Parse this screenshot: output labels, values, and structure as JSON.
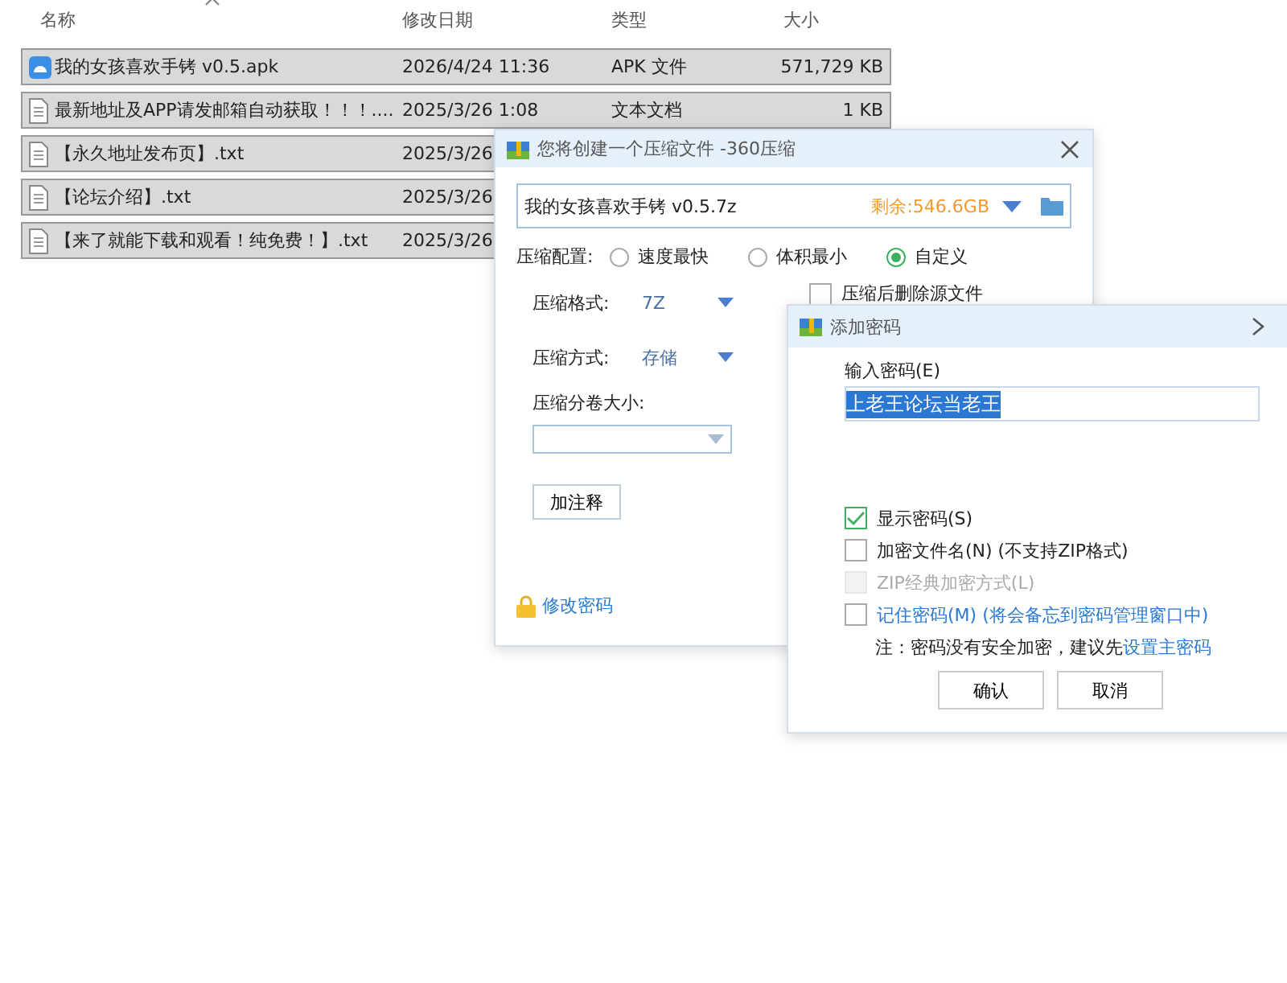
{
  "explorer": {
    "columns": [
      "名称",
      "修改日期",
      "类型",
      "大小"
    ],
    "rows": [
      {
        "kind": "apk",
        "name": "我的女孩喜欢手铐 v0.5.apk",
        "date": "2026/4/24 11:36",
        "type": "APK 文件",
        "size": "571,729 KB",
        "selected": true
      },
      {
        "kind": "txt",
        "name": "最新地址及APP请发邮箱自动获取！！！....",
        "date": "2025/3/26 1:08",
        "type": "文本文档",
        "size": "1 KB",
        "selected": true
      },
      {
        "kind": "txt",
        "name": "【永久地址发布页】.txt",
        "date": "2025/3/26",
        "selected": true
      },
      {
        "kind": "txt",
        "name": "【论坛介绍】.txt",
        "date": "2025/3/26",
        "selected": true
      },
      {
        "kind": "txt",
        "name": "【来了就能下载和观看！纯免费！】.txt",
        "date": "2025/3/26",
        "selected": true
      }
    ]
  },
  "compress_dialog": {
    "title": "您将创建一个压缩文件 -360压缩",
    "filename": "我的女孩喜欢手铐 v0.5.7z",
    "free_space": "剩余:546.6GB",
    "config_label": "压缩配置:",
    "presets": [
      {
        "label": "速度最快",
        "selected": false
      },
      {
        "label": "体积最小",
        "selected": false
      },
      {
        "label": "自定义",
        "selected": true
      }
    ],
    "format_label": "压缩格式:",
    "format": "7Z",
    "method_label": "压缩方式:",
    "method": "存储",
    "volume_label": "压缩分卷大小:",
    "comment_button": "加注释",
    "delete_source": {
      "label": "压缩后删除源文件",
      "checked": false
    },
    "change_password": "修改密码"
  },
  "password_dialog": {
    "title": "添加密码",
    "input_label": "输入密码(E)",
    "password": "上老王论坛当老王",
    "options": [
      {
        "label": "显示密码(S)",
        "checked": true,
        "disabled": false,
        "link": false
      },
      {
        "label": "加密文件名(N) (不支持ZIP格式)",
        "checked": false,
        "disabled": false,
        "link": false
      },
      {
        "label": "ZIP经典加密方式(L)",
        "checked": false,
        "disabled": true,
        "link": false
      },
      {
        "label": "记住密码(M) (将会备忘到密码管理窗口中)",
        "checked": false,
        "disabled": false,
        "link": true
      }
    ],
    "note": "注：密码没有安全加密，建议先",
    "note_link": "设置主密码",
    "buttons": [
      "确认",
      "取消"
    ]
  }
}
